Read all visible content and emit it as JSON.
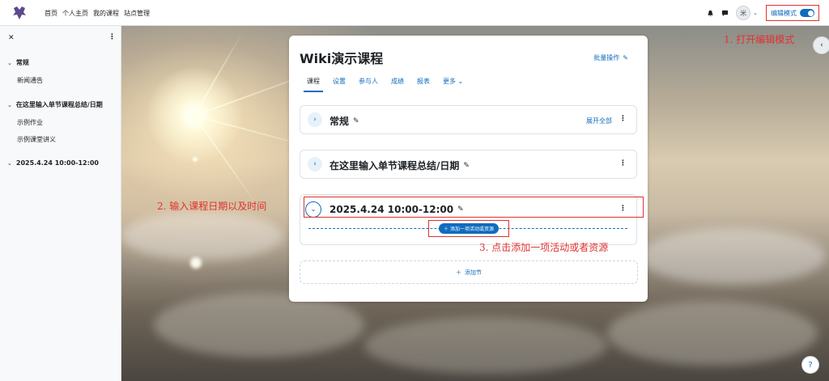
{
  "nav": {
    "items": [
      "首页",
      "个人主页",
      "我的课程",
      "站点管理"
    ],
    "edit_mode_label": "编辑模式",
    "avatar_initials": "米"
  },
  "drawer": {
    "sections": [
      {
        "label": "常规",
        "items": [
          "新闻通告"
        ]
      },
      {
        "label": "在这里输入单节课程总结/日期",
        "items": [
          "示例作业",
          "示例课堂讲义"
        ]
      },
      {
        "label": "2025.4.24 10:00-12:00",
        "items": []
      }
    ]
  },
  "course": {
    "title": "Wiki演示课程",
    "bulk_label": "批量操作",
    "tabs": [
      "课程",
      "设置",
      "参与人",
      "成绩",
      "报表",
      "更多"
    ],
    "expand_all": "展开全部",
    "sections": [
      "常规",
      "在这里输入单节课程总结/日期",
      "2025.4.24 10:00-12:00"
    ],
    "add_activity": "添加一项活动或资源",
    "add_section": "添加节"
  },
  "annotations": {
    "step1": "1. 打开编辑模式",
    "step2": "2. 输入课程日期以及时间",
    "step3": "3. 点击添加一项活动或者资源"
  },
  "colors": {
    "accent": "#0f6cbf",
    "annotation": "#e0322f"
  }
}
